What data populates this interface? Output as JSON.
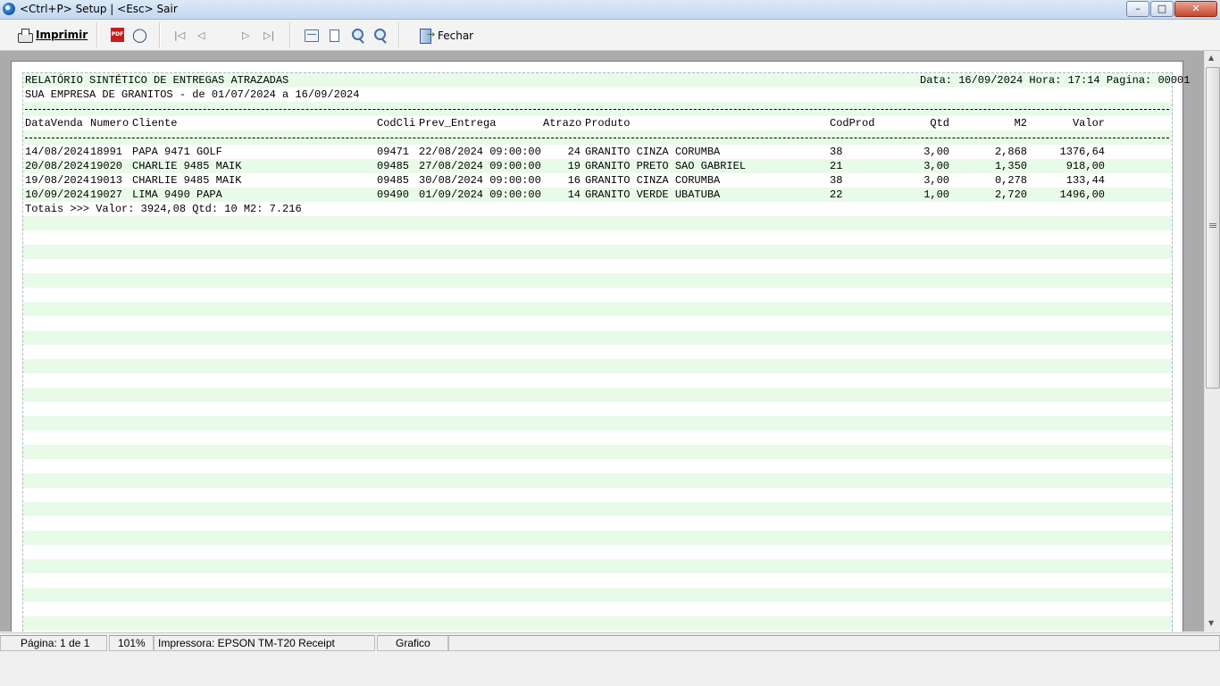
{
  "window": {
    "title": "<Ctrl+P> Setup | <Esc> Sair",
    "controls": {
      "minimize": "–",
      "maximize": "□",
      "close": "✕"
    }
  },
  "toolbar": {
    "print_label": "Imprimir",
    "pdf_icon_text": "PDF",
    "close_label": "Fechar",
    "icons": [
      "printer-icon",
      "pdf-icon",
      "binoculars-icon",
      "first-page-icon",
      "previous-page-icon",
      "next-page-icon",
      "last-page-icon",
      "page-width-icon",
      "whole-page-icon",
      "zoom-in-icon",
      "zoom-out-icon",
      "exit-door-icon"
    ]
  },
  "report": {
    "title": "RELATÓRIO SINTÉTICO DE ENTREGAS ATRAZADAS",
    "company_period": "SUA EMPRESA DE GRANITOS - de 01/07/2024 a 16/09/2024",
    "header_info": "Data: 16/09/2024 Hora: 17:14 Pagina: 00001",
    "columns": [
      "DataVenda",
      "Numero",
      "Cliente",
      "CodCli",
      "Prev_Entrega",
      "Atrazo",
      "Produto",
      "CodProd",
      "Qtd",
      "M2",
      "Valor"
    ],
    "rows": [
      [
        "14/08/2024",
        "18991",
        "PAPA 9471 GOLF",
        "09471",
        "22/08/2024 09:00:00",
        "24",
        "GRANITO CINZA CORUMBA",
        "38",
        "3,00",
        "2,868",
        "1376,64"
      ],
      [
        "20/08/2024",
        "19020",
        "CHARLIE 9485 MAIK",
        "09485",
        "27/08/2024 09:00:00",
        "19",
        "GRANITO PRETO SAO GABRIEL",
        "21",
        "3,00",
        "1,350",
        "918,00"
      ],
      [
        "19/08/2024",
        "19013",
        "CHARLIE 9485 MAIK",
        "09485",
        "30/08/2024 09:00:00",
        "16",
        "GRANITO CINZA CORUMBA",
        "38",
        "3,00",
        "0,278",
        "133,44"
      ],
      [
        "10/09/2024",
        "19027",
        "LIMA 9490 PAPA",
        "09490",
        "01/09/2024 09:00:00",
        "14",
        "GRANITO VERDE UBATUBA",
        "22",
        "1,00",
        "2,720",
        "1496,00"
      ]
    ],
    "totals": "Totais >>> Valor: 3924,08 Qtd: 10 M2: 7.216"
  },
  "statusbar": {
    "page": "Página: 1 de 1",
    "zoom": "101%",
    "printer": "Impressora: EPSON TM-T20 Receipt",
    "mode": "Grafico"
  },
  "colors": {
    "band_green": "#e8fbe8",
    "preview_bg": "#ababab",
    "titlebar": "#c4d8f0"
  }
}
